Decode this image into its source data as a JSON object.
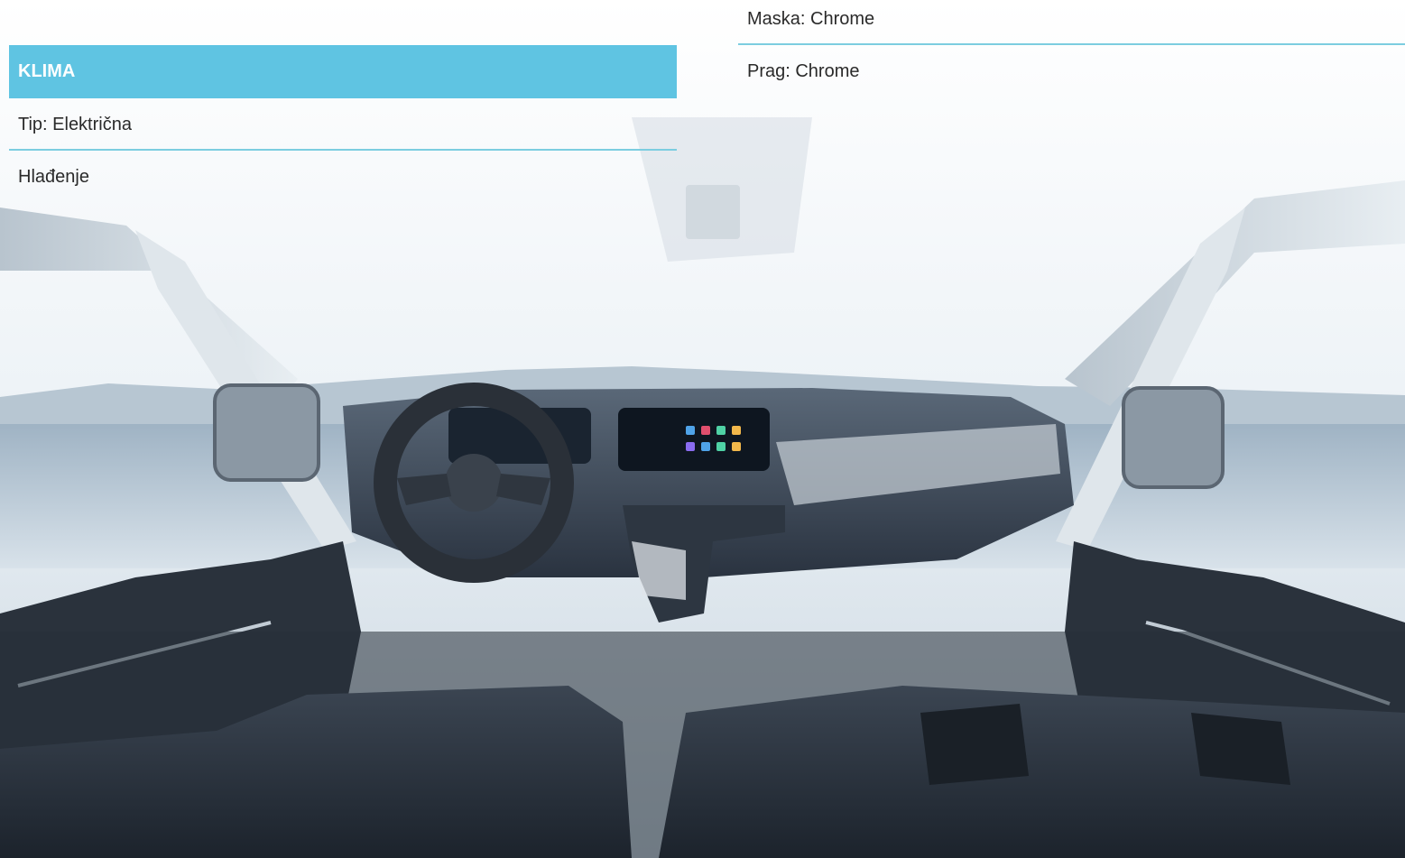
{
  "left_panel": {
    "header": "KLIMA",
    "rows": [
      "Tip: Električna",
      "Hlađenje"
    ]
  },
  "right_panel": {
    "rows": [
      "Maska: Chrome",
      "Prag: Chrome"
    ]
  },
  "colors": {
    "header_bg": "#5fc4e2",
    "divider": "#7ccde0",
    "interior_dark": "#2a3340",
    "sky": "#f2f6f9"
  }
}
